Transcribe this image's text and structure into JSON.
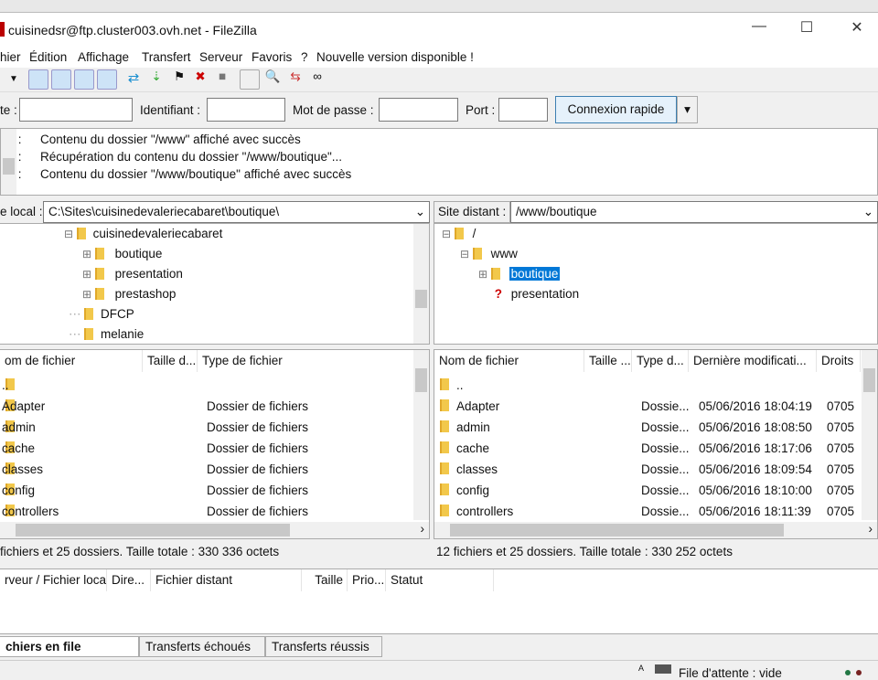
{
  "window": {
    "title": "cuisinedsr@ftp.cluster003.ovh.net - FileZilla",
    "minimize": "—",
    "maximize": "☐",
    "close": "✕"
  },
  "menu": [
    "hier",
    "Édition",
    "Affichage",
    "Transfert",
    "Serveur",
    "Favoris",
    "?",
    "Nouvelle version disponible !"
  ],
  "quickconnect": {
    "host_label": "te :",
    "host_value": "",
    "user_label": "Identifiant :",
    "user_value": "",
    "pass_label": "Mot de passe :",
    "pass_value": "",
    "port_label": "Port :",
    "port_value": "",
    "connect": "Connexion rapide",
    "dropdown": "▾"
  },
  "log": [
    {
      "type": "tut :",
      "msg": "Contenu du dossier \"/www\" affiché avec succès"
    },
    {
      "type": "tut :",
      "msg": "Récupération du contenu du dossier \"/www/boutique\"..."
    },
    {
      "type": "tut :",
      "msg": "Contenu du dossier \"/www/boutique\" affiché avec succès"
    }
  ],
  "local": {
    "label": "e local :",
    "path": "C:\\Sites\\cuisinedevaleriecabaret\\boutique\\",
    "tree": [
      {
        "name": "cuisinedevaleriecabaret",
        "level": 0,
        "exp": "⊟"
      },
      {
        "name": "boutique",
        "level": 1,
        "exp": "⊞"
      },
      {
        "name": "presentation",
        "level": 1,
        "exp": "⊞"
      },
      {
        "name": "prestashop",
        "level": 1,
        "exp": "⊞"
      },
      {
        "name": "DFCP",
        "level": -1,
        "exp": ""
      },
      {
        "name": "melanie",
        "level": -1,
        "exp": ""
      }
    ],
    "columns": [
      "om de fichier",
      "Taille d...",
      "Type de fichier"
    ],
    "files": [
      {
        "name": "..",
        "type": ""
      },
      {
        "name": "Adapter",
        "type": "Dossier de fichiers"
      },
      {
        "name": "admin",
        "type": "Dossier de fichiers"
      },
      {
        "name": "cache",
        "type": "Dossier de fichiers"
      },
      {
        "name": "classes",
        "type": "Dossier de fichiers"
      },
      {
        "name": "config",
        "type": "Dossier de fichiers"
      },
      {
        "name": "controllers",
        "type": "Dossier de fichiers"
      }
    ],
    "status": "fichiers et 25 dossiers. Taille totale : 330 336 octets"
  },
  "remote": {
    "label": "Site distant :",
    "path": "/www/boutique",
    "tree": [
      "/",
      "www",
      "boutique",
      "presentation"
    ],
    "columns": [
      "Nom de fichier",
      "Taille ...",
      "Type d...",
      "Dernière modificati...",
      "Droits"
    ],
    "files": [
      {
        "name": "..",
        "type": "",
        "date": "",
        "perm": ""
      },
      {
        "name": "Adapter",
        "type": "Dossie...",
        "date": "05/06/2016 18:04:19",
        "perm": "0705"
      },
      {
        "name": "admin",
        "type": "Dossie...",
        "date": "05/06/2016 18:08:50",
        "perm": "0705"
      },
      {
        "name": "cache",
        "type": "Dossie...",
        "date": "05/06/2016 18:17:06",
        "perm": "0705"
      },
      {
        "name": "classes",
        "type": "Dossie...",
        "date": "05/06/2016 18:09:54",
        "perm": "0705"
      },
      {
        "name": "config",
        "type": "Dossie...",
        "date": "05/06/2016 18:10:00",
        "perm": "0705"
      },
      {
        "name": "controllers",
        "type": "Dossie...",
        "date": "05/06/2016 18:11:39",
        "perm": "0705"
      }
    ],
    "status": "12 fichiers et 25 dossiers. Taille totale : 330 252 octets"
  },
  "queue": {
    "columns": [
      "rveur / Fichier local",
      "Dire...",
      "Fichier distant",
      "Taille",
      "Prio...",
      "Statut"
    ]
  },
  "tabs": [
    "chiers en file d'attente",
    "Transferts échoués",
    "Transferts réussis"
  ],
  "statusbar": {
    "queue": "File d'attente : vide"
  }
}
